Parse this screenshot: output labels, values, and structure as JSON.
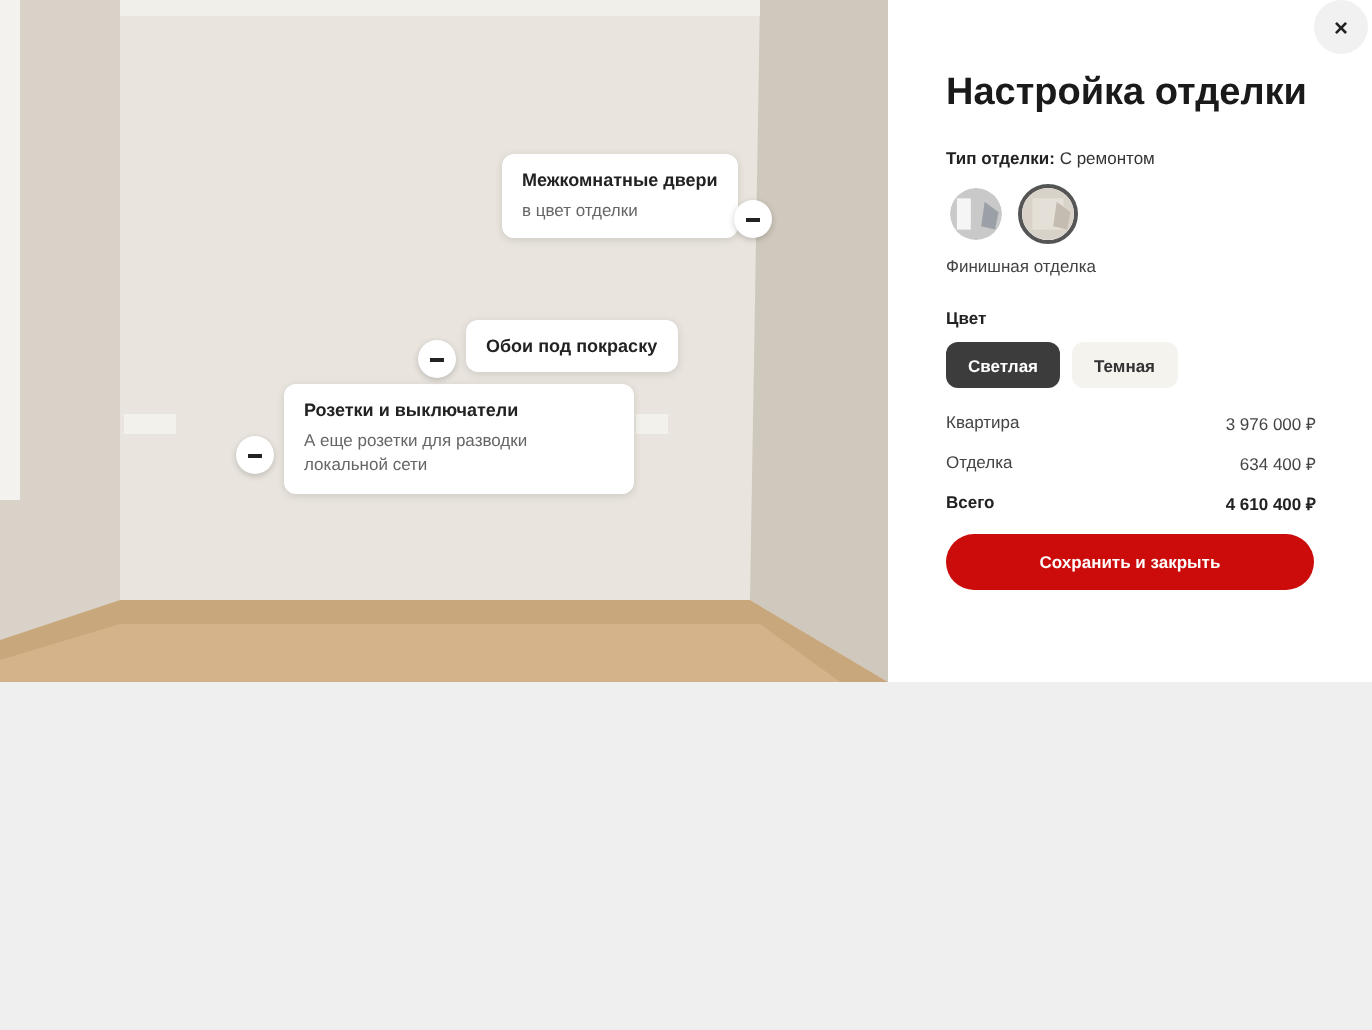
{
  "hotspots": [
    {
      "title": "Межкомнатные двери",
      "subtitle": "в цвет отделки",
      "expanded": true
    },
    {
      "title": "Обои под покраску",
      "expanded": true
    },
    {
      "title": "Розетки и выключатели",
      "subtitle": "А еще розетки для разводки локальной сети",
      "expanded": true
    }
  ],
  "panel": {
    "close": "×",
    "title": "Настройка отделки",
    "type_label": "Тип отделки:",
    "type_value": "С ремонтом",
    "finishes": [
      {
        "selected": false
      },
      {
        "selected": true
      }
    ],
    "finish_caption": "Финишная отделка",
    "color_label": "Цвет",
    "colors": [
      {
        "label": "Светлая",
        "selected": true
      },
      {
        "label": "Темная",
        "selected": false
      }
    ],
    "prices": [
      {
        "label": "Квартира",
        "value": "3 976 000 ₽",
        "total": false
      },
      {
        "label": "Отделка",
        "value": "634 400 ₽",
        "total": false
      },
      {
        "label": "Всего",
        "value": "4 610 400 ₽",
        "total": true
      }
    ],
    "save": "Сохранить и закрыть"
  }
}
